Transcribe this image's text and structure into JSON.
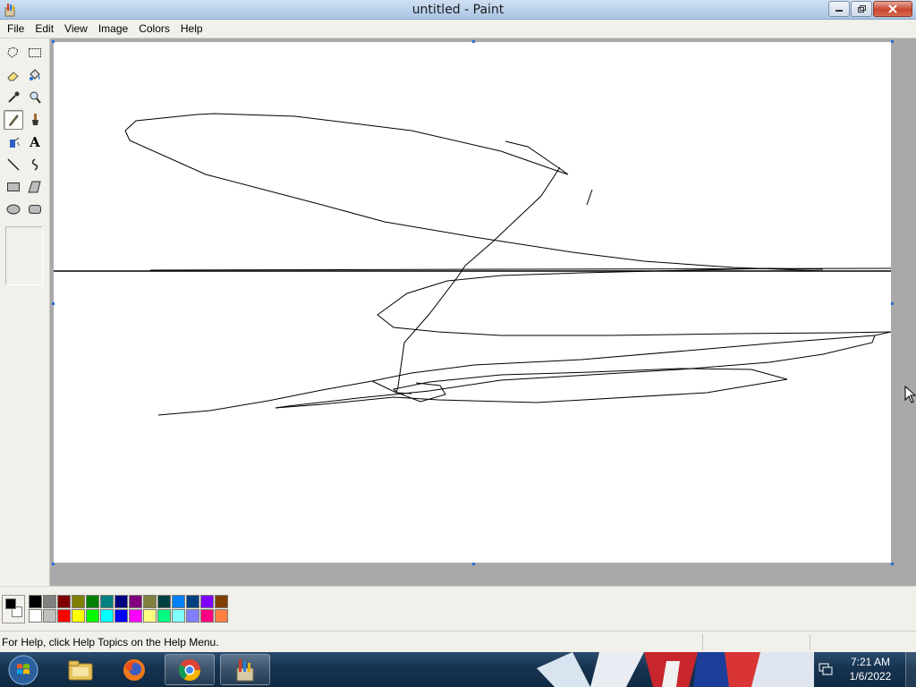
{
  "window": {
    "title": "untitled - Paint"
  },
  "menu": {
    "items": [
      "File",
      "Edit",
      "View",
      "Image",
      "Colors",
      "Help"
    ]
  },
  "tools": [
    {
      "name": "free-form-select-icon"
    },
    {
      "name": "select-icon"
    },
    {
      "name": "eraser-icon"
    },
    {
      "name": "fill-icon"
    },
    {
      "name": "pick-color-icon"
    },
    {
      "name": "magnifier-icon"
    },
    {
      "name": "pencil-icon",
      "active": true
    },
    {
      "name": "brush-icon"
    },
    {
      "name": "airbrush-icon"
    },
    {
      "name": "text-icon"
    },
    {
      "name": "line-icon"
    },
    {
      "name": "curve-icon"
    },
    {
      "name": "rectangle-icon"
    },
    {
      "name": "polygon-icon"
    },
    {
      "name": "ellipse-icon"
    },
    {
      "name": "rounded-rectangle-icon"
    }
  ],
  "text_tool_glyph": "A",
  "palette": {
    "foreground": "#000000",
    "background": "#ffffff",
    "colors": [
      "#000000",
      "#808080",
      "#800000",
      "#808000",
      "#008000",
      "#008080",
      "#000080",
      "#800080",
      "#808040",
      "#004040",
      "#0080ff",
      "#004080",
      "#8000ff",
      "#804000",
      "#ffffff",
      "#c0c0c0",
      "#ff0000",
      "#ffff00",
      "#00ff00",
      "#00ffff",
      "#0000ff",
      "#ff00ff",
      "#ffff80",
      "#00ff80",
      "#80ffff",
      "#8080ff",
      "#ff0080",
      "#ff8040"
    ]
  },
  "status": {
    "help_text": "For Help, click Help Topics on the Help Menu."
  },
  "taskbar": {
    "clock_time": "7:21 AM",
    "clock_date": "1/6/2022",
    "apps": [
      {
        "name": "windows-explorer-icon",
        "open": false
      },
      {
        "name": "firefox-icon",
        "open": false
      },
      {
        "name": "chrome-icon",
        "open": true
      },
      {
        "name": "paint-icon",
        "open": true
      }
    ]
  }
}
